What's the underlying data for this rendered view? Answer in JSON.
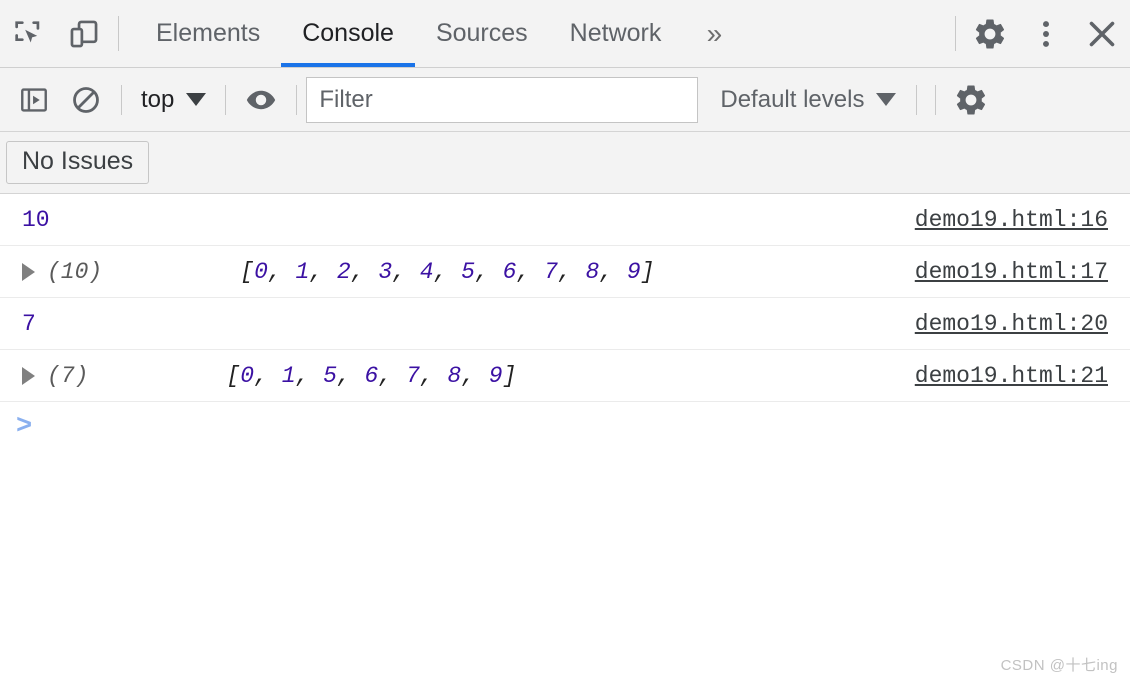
{
  "tabbar": {
    "inspect_icon": "inspect-element-icon",
    "device_icon": "device-toolbar-icon",
    "tabs": [
      {
        "label": "Elements",
        "active": false
      },
      {
        "label": "Console",
        "active": true
      },
      {
        "label": "Sources",
        "active": false
      },
      {
        "label": "Network",
        "active": false
      }
    ],
    "more_tabs_label": "»",
    "settings_icon": "gear-icon",
    "menu_icon": "three-dot-menu-icon",
    "close_icon": "close-icon"
  },
  "filterbar": {
    "sidebar_icon": "console-sidebar-toggle-icon",
    "clear_icon": "clear-console-icon",
    "context": "top",
    "eye_icon": "live-expression-eye-icon",
    "filter_placeholder": "Filter",
    "filter_value": "",
    "levels": "Default levels",
    "settings_icon": "gear-icon"
  },
  "issuesbar": {
    "issues_label": "No Issues"
  },
  "console": {
    "messages": [
      {
        "expandable": false,
        "text": "10",
        "kind": "number",
        "source": "demo19.html:16"
      },
      {
        "expandable": true,
        "count": "(10)",
        "open_bracket": "[",
        "items": [
          "0",
          "1",
          "2",
          "3",
          "4",
          "5",
          "6",
          "7",
          "8",
          "9"
        ],
        "close_bracket": "]",
        "separator": ", ",
        "kind": "array",
        "source": "demo19.html:17"
      },
      {
        "expandable": false,
        "text": "7",
        "kind": "number",
        "source": "demo19.html:20"
      },
      {
        "expandable": true,
        "count": "(7)",
        "open_bracket": "[",
        "items": [
          "0",
          "1",
          "5",
          "6",
          "7",
          "8",
          "9"
        ],
        "close_bracket": "]",
        "separator": ", ",
        "kind": "array",
        "source": "demo19.html:21"
      }
    ],
    "prompt": ">"
  },
  "watermark": "CSDN @十七ing",
  "colors": {
    "accent": "#1a73e8",
    "number": "#3b11a3",
    "toolbar_bg": "#f3f3f3",
    "link": "#3c4043",
    "prompt": "#8ab0ef"
  }
}
